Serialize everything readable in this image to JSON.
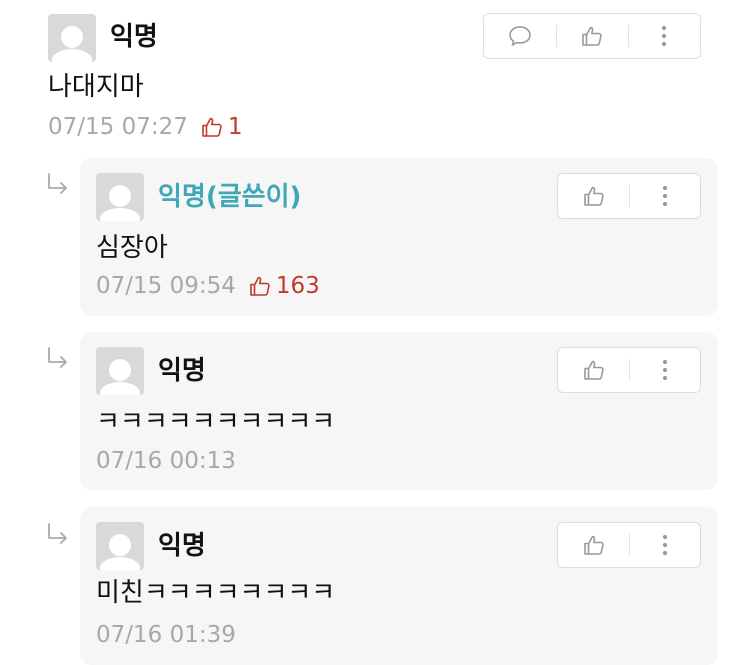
{
  "comments": [
    {
      "author": "익명",
      "text": "나대지마",
      "time": "07/15 07:27",
      "likes": "1"
    }
  ],
  "replies": [
    {
      "author": "익명(글쓴이)",
      "text": "심장아",
      "time": "07/15 09:54",
      "likes": "163"
    },
    {
      "author": "익명",
      "text": "ㅋㅋㅋㅋㅋㅋㅋㅋㅋㅋ",
      "time": "07/16 00:13"
    },
    {
      "author": "익명",
      "text": "미친ㅋㅋㅋㅋㅋㅋㅋㅋ",
      "time": "07/16 01:39"
    }
  ],
  "colors": {
    "author_name": "#3fa7b5",
    "like_count": "#c0392b",
    "meta_text": "#a8a8a8",
    "reply_bg": "#f6f6f6"
  },
  "icons": {
    "comment_action": "speech-bubble-icon",
    "like_action": "thumbs-up-icon",
    "more_action": "vertical-ellipsis-icon",
    "reply_marker": "reply-arrow-icon",
    "avatar": "default-avatar-icon"
  }
}
